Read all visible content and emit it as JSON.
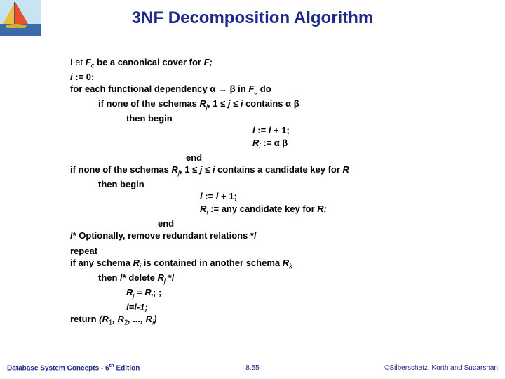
{
  "title": "3NF Decomposition Algorithm",
  "lines": {
    "l1a": "Let ",
    "l1b": "F",
    "l1c": "c",
    "l1d": " be a canonical cover for ",
    "l1e": "F;",
    "l2a": "i",
    "l2b": " := 0;",
    "l3a": "for each ",
    "l3b": " functional dependency α → β in ",
    "l3c": "F",
    "l3d": "c",
    "l3e": " do",
    "l4a": "if none of the schemas ",
    "l4b": "R",
    "l4c": "j",
    "l4d": ", 1 ≤ ",
    "l4e": "j",
    "l4f": " ≤ ",
    "l4g": "i",
    "l4h": " contains α β",
    "l5": "then begin",
    "l6a": "i",
    "l6b": " := ",
    "l6c": "i ",
    "l6d": " + 1;",
    "l7a": "R",
    "l7b": "i",
    "l7c": " := α β",
    "l8": "end",
    "l9a": "if none of the schemas ",
    "l9b": "R",
    "l9c": "j",
    "l9d": ", 1 ≤ ",
    "l9e": "j",
    "l9f": " ≤ ",
    "l9g": "i",
    "l9h": " contains a candidate key for ",
    "l9i": "R",
    "l10": "then begin",
    "l11a": "i",
    "l11b": " := ",
    "l11c": "i ",
    "l11d": " + 1;",
    "l12a": "R",
    "l12b": "i",
    "l12c": " := any candidate key for ",
    "l12d": "R;",
    "l13": "end",
    "l14": "/* Optionally, remove redundant relations */",
    "l15": "repeat",
    "l16a": "if any schema ",
    "l16b": "R",
    "l16c": "j",
    "l16d": " is contained in another schema ",
    "l16e": "R",
    "l16f": "k",
    "l17a": "then /* delete ",
    "l17b": "R",
    "l17c": "j",
    "l17d": " */",
    "l18a": "R",
    "l18b": "j",
    "l18c": " = ",
    "l18d": "R",
    "l18e": "i",
    "l18f": "; ;",
    "l19": "i=i-1;",
    "l20a": "return ",
    "l20b": "(R",
    "l20c": "1",
    "l20d": ", R",
    "l20e": "2",
    "l20f": ", ..., R",
    "l20g": "i",
    "l20h": ")"
  },
  "footer": {
    "left_a": "Database System Concepts - 6",
    "left_b": "th",
    "left_c": " Edition",
    "center": "8.55",
    "right": "©Silberschatz, Korth and Sudarshan"
  }
}
